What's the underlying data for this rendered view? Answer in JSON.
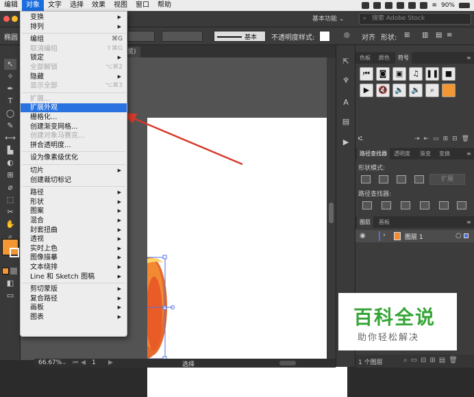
{
  "menubar": {
    "items": [
      "编辑",
      "对象",
      "文字",
      "选择",
      "效果",
      "视图",
      "窗口",
      "帮助"
    ],
    "active_index": 1,
    "battery": "90%"
  },
  "appbar": {
    "workspace": "基本功能",
    "stock_placeholder": "搜索 Adobe Stock"
  },
  "control": {
    "left_label": "椭圆",
    "stroke_style": "基本",
    "opacity_label": "不透明度",
    "style_label": "样式:",
    "align_label": "对齐",
    "shape_label": "形状:"
  },
  "doc_tab": "览)",
  "object_menu": {
    "groups": [
      [
        {
          "label": "变换",
          "submenu": true
        },
        {
          "label": "排列",
          "submenu": true
        }
      ],
      [
        {
          "label": "编组",
          "shortcut": "⌘G"
        },
        {
          "label": "取消编组",
          "shortcut": "⇧⌘G",
          "disabled": true
        },
        {
          "label": "锁定",
          "submenu": true
        },
        {
          "label": "全部解锁",
          "shortcut": "⌥⌘2",
          "disabled": true
        },
        {
          "label": "隐藏",
          "submenu": true
        },
        {
          "label": "显示全部",
          "shortcut": "⌥⌘3",
          "disabled": true
        }
      ],
      [
        {
          "label": "扩展...",
          "disabled": true
        },
        {
          "label": "扩展外观",
          "highlighted": true
        },
        {
          "label": "栅格化..."
        },
        {
          "label": "创建渐变网格..."
        },
        {
          "label": "创建对象马赛克...",
          "disabled": true
        },
        {
          "label": "拼合透明度..."
        }
      ],
      [
        {
          "label": "设为像素级优化"
        }
      ],
      [
        {
          "label": "切片",
          "submenu": true
        },
        {
          "label": "创建裁切标记"
        }
      ],
      [
        {
          "label": "路径",
          "submenu": true
        },
        {
          "label": "形状",
          "submenu": true
        },
        {
          "label": "图案",
          "submenu": true
        },
        {
          "label": "混合",
          "submenu": true
        },
        {
          "label": "封套扭曲",
          "submenu": true
        },
        {
          "label": "透视",
          "submenu": true
        },
        {
          "label": "实时上色",
          "submenu": true
        },
        {
          "label": "图像描摹",
          "submenu": true
        },
        {
          "label": "文本绕排",
          "submenu": true
        },
        {
          "label": "Line 和 Sketch 图稿",
          "submenu": true
        }
      ],
      [
        {
          "label": "剪切蒙版",
          "submenu": true
        },
        {
          "label": "复合路径",
          "submenu": true
        },
        {
          "label": "画板",
          "submenu": true
        },
        {
          "label": "图表",
          "submenu": true
        }
      ]
    ]
  },
  "panels": {
    "top_tabs": [
      "色板",
      "颜色",
      "符号"
    ],
    "pathfinder_tabs": [
      "路径查找器",
      "透明度",
      "渐变",
      "变换"
    ],
    "shape_modes": "形状模式:",
    "expand": "扩展",
    "pathfinder_label": "路径查找器:",
    "layers_tabs": [
      "图层",
      "画板"
    ],
    "layer_name": "图层 1",
    "layer_count": "1 个图层"
  },
  "status": {
    "zoom": "66.67%",
    "page": "1",
    "tool": "选择"
  },
  "watermark": {
    "title": "百科全说",
    "subtitle": "助你轻松解决"
  },
  "colors": {
    "fill": "#f29733",
    "pumpkin_dark": "#e8622a",
    "pumpkin_mid": "#f28a34",
    "highlight": "#2a72df",
    "arrow": "#d63a2a",
    "watermark_green": "#35a535"
  }
}
